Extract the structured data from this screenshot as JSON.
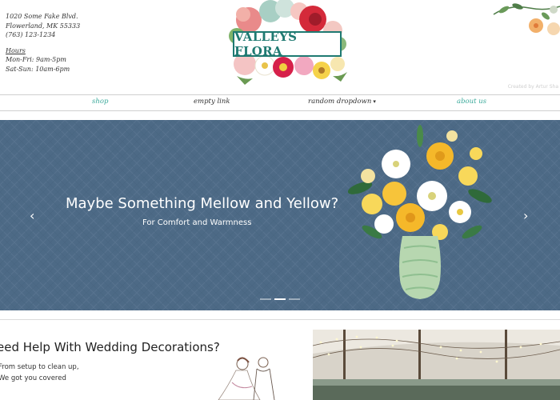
{
  "header": {
    "address_line1": "1020 Some Fake Blvd.",
    "address_line2": "Flowerland, MK 55333",
    "phone": "(763) 123-1234",
    "hours_title": "Hours",
    "hours_weekday": "Mon-Fri: 9am-5pm",
    "hours_weekend": "Sat-Sun: 10am-6pm",
    "logo_text": "VALLEYS FLORA",
    "credit": "Created by Artur Sha"
  },
  "nav": {
    "shop": "shop",
    "empty_link": "empty link",
    "random_dropdown": "random dropdown",
    "about_us": "about us"
  },
  "hero": {
    "title": "Maybe Something Mellow and Yellow?",
    "subtitle": "For Comfort and Warmness",
    "prev_arrow": "‹",
    "next_arrow": "›",
    "slide_count": 3,
    "active_slide": 2
  },
  "wedding": {
    "title": "eed Help With Wedding Decorations?",
    "line1": "From setup to clean up,",
    "line2": "We got you covered"
  },
  "colors": {
    "teal": "#3aa99a",
    "hero_bg": "#4d6a86",
    "logo": "#1f7a72"
  }
}
